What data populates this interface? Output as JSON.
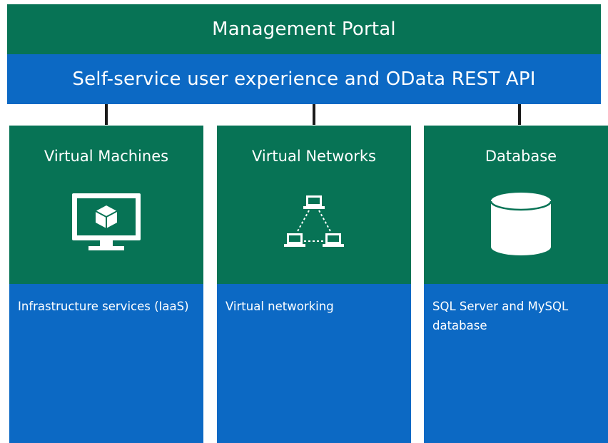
{
  "header": {
    "portal_label": "Management Portal",
    "api_label": "Self-service user experience and OData REST API"
  },
  "columns": [
    {
      "title": "Virtual Machines",
      "icon": "virtual-machine-monitor-icon",
      "description": "Infrastructure services (IaaS)"
    },
    {
      "title": "Virtual Networks",
      "icon": "network-topology-icon",
      "description": "Virtual networking"
    },
    {
      "title": "Database",
      "icon": "database-cylinder-icon",
      "description": "SQL Server and MySQL database"
    }
  ],
  "colors": {
    "green": "#077355",
    "blue": "#0c69c4",
    "white": "#ffffff",
    "connector": "#1a1a1a"
  }
}
